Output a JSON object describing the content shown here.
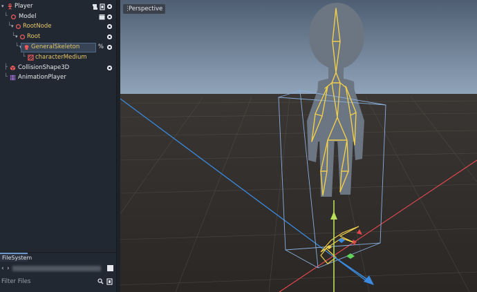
{
  "scene_tree": {
    "nodes": [
      {
        "label": "Player",
        "color": "#e6e9ee"
      },
      {
        "label": "Model",
        "color": "#e6e9ee"
      },
      {
        "label": "RootNode",
        "color": "#e8c86a"
      },
      {
        "label": "Root",
        "color": "#e8c86a"
      },
      {
        "label": "GeneralSkeleton",
        "color": "#e8c86a"
      },
      {
        "label": "characterMedium",
        "color": "#e8c86a"
      },
      {
        "label": "CollisionShape3D",
        "color": "#e6e9ee"
      },
      {
        "label": "AnimationPlayer",
        "color": "#e6e9ee"
      }
    ],
    "selected_suffix": "%"
  },
  "filesystem": {
    "tab_label": "FileSystem",
    "filter_placeholder": "Filter Files"
  },
  "viewport": {
    "perspective_label": "Perspective"
  }
}
